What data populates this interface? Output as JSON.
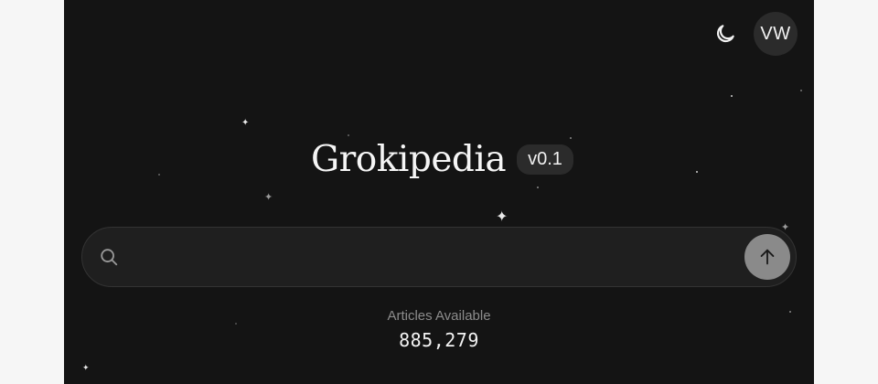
{
  "header": {
    "theme_toggle_icon": "moon-icon",
    "avatar_initials": "VW"
  },
  "brand": {
    "title": "Grokipedia",
    "version": "v0.1"
  },
  "search": {
    "placeholder": "",
    "value": "",
    "search_icon": "search-icon",
    "submit_icon": "arrow-up-icon"
  },
  "stats": {
    "label": "Articles Available",
    "value": "885,279"
  },
  "colors": {
    "background": "#141414",
    "search_bg": "#1f1f1f",
    "submit_button": "#8a8a8a",
    "badge_bg": "#2b2b2b"
  }
}
